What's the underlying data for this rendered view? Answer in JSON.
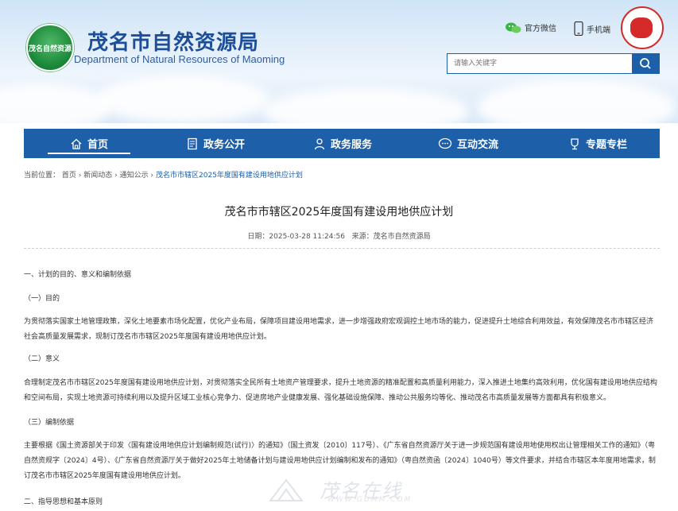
{
  "header": {
    "title": "茂名市自然资源局",
    "subtitle": "Department of Natural Resources of Maoming",
    "logo_text": "茂名自然资源",
    "wechat_label": "官方微信",
    "mobile_label": "手机端",
    "search_placeholder": "请输入关键字"
  },
  "nav": {
    "items": [
      {
        "label": "首页",
        "icon": "home-icon"
      },
      {
        "label": "政务公开",
        "icon": "document-icon"
      },
      {
        "label": "政务服务",
        "icon": "service-icon"
      },
      {
        "label": "互动交流",
        "icon": "chat-icon"
      },
      {
        "label": "专题专栏",
        "icon": "trophy-icon"
      }
    ],
    "active": "首页"
  },
  "breadcrumb": {
    "prefix": "当前位置：",
    "items": [
      "首页",
      "新闻动态",
      "通知公示"
    ],
    "separator": "›",
    "current": "茂名市市辖区2025年度国有建设用地供应计划"
  },
  "article": {
    "title": "茂名市市辖区2025年度国有建设用地供应计划",
    "date_label": "日期：",
    "date": "2025-03-28 11:24:56",
    "source_label": "来源：",
    "source": "茂名市自然资源局",
    "paragraphs": [
      "一、计划的目的、意义和编制依据",
      "（一）目的",
      "为贯彻落实国家土地管理政策，深化土地要素市场化配置，优化产业布局，保障项目建设用地需求，进一步增强政府宏观调控土地市场的能力，促进提升土地综合利用效益，有效保障茂名市市辖区经济社会高质量发展需求，现制订茂名市市辖区2025年度国有建设用地供应计划。",
      "（二）意义",
      "合理制定茂名市市辖区2025年度国有建设用地供应计划，对贯彻落实全民所有土地资产管理要求，提升土地资源的精准配置和高质量利用能力，深入推进土地集约高效利用，优化国有建设用地供应结构和空间布局，实现土地资源可持续利用以及提升区域工业核心竞争力、促进房地产业健康发展、强化基础设施保障、推动公共服务均等化、推动茂名市高质量发展等方面都具有积极意义。",
      "（三）编制依据",
      "主要根据《国土资源部关于印发〈国有建设用地供应计划编制规范(试行)〉的通知》（国土资发〔2010〕117号）、《广东省自然资源厅关于进一步规范国有建设用地使用权出让管理相关工作的通知》（粤自然资规字〔2024〕4号）、《广东省自然资源厅关于做好2025年土地储备计划与建设用地供应计划编制和发布的通知》（粤自然资函〔2024〕1040号）等文件要求，并结合市辖区本年度用地需求，制订茂名市市辖区2025年度国有建设用地供应计划。",
      "二、指导思想和基本原则"
    ]
  },
  "watermark": {
    "text": "茂名在线",
    "url": "WWW.GDMM.COM"
  },
  "colors": {
    "brand_blue": "#1d5fa8",
    "title_blue": "#1d4f98",
    "logo_green": "#1e8d3c",
    "badge_red": "#d42a2a"
  }
}
